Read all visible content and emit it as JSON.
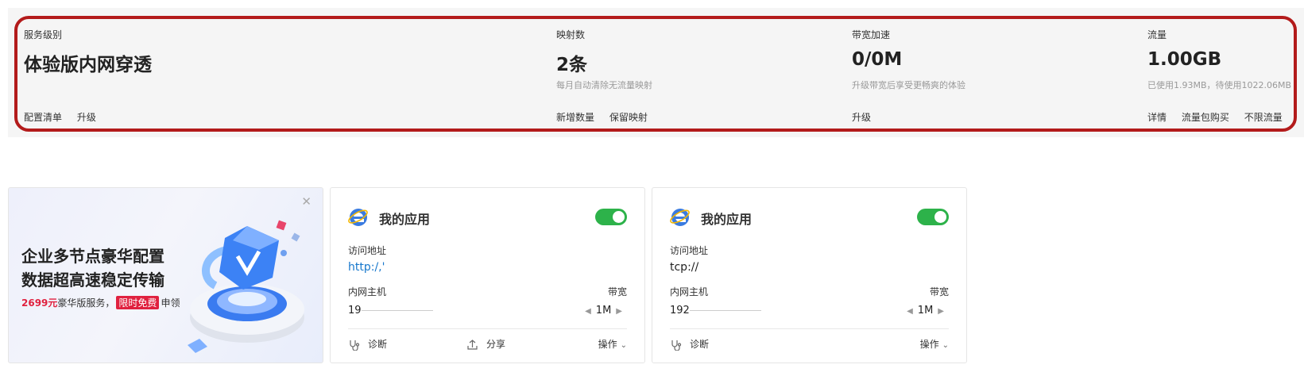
{
  "stats": {
    "service": {
      "label": "服务级别",
      "value": "体验版内网穿透",
      "links": [
        "配置清单",
        "升级"
      ]
    },
    "mapping": {
      "label": "映射数",
      "value": "2条",
      "sub": "每月自动清除无流量映射",
      "links": [
        "新增数量",
        "保留映射"
      ]
    },
    "bandwidth": {
      "label": "带宽加速",
      "value": "0/0M",
      "sub": "升级带宽后享受更畅爽的体验",
      "links": [
        "升级"
      ]
    },
    "traffic": {
      "label": "流量",
      "value": "1.00GB",
      "sub": "已使用1.93MB，待使用1022.06MB",
      "links": [
        "详情",
        "流量包购买",
        "不限流量"
      ]
    }
  },
  "promo": {
    "line1": "企业多节点豪华配置",
    "line2": "数据超高速稳定传输",
    "price": "2699元",
    "text": "豪华版服务，",
    "badge": "限时免费",
    "suffix": "申领",
    "close_icon": "close-icon"
  },
  "cards": [
    {
      "title": "我的应用",
      "enabled": true,
      "addr_label": "访问地址",
      "addr_value": "http:/,'",
      "host_label": "内网主机",
      "host_value": "19",
      "bw_label": "带宽",
      "bw_value": "1M",
      "actions": {
        "diag": "诊断",
        "share": "分享",
        "ops": "操作"
      }
    },
    {
      "title": "我的应用",
      "enabled": true,
      "addr_label": "访问地址",
      "addr_value": "tcp://",
      "host_label": "内网主机",
      "host_value": "192",
      "bw_label": "带宽",
      "bw_value": "1M",
      "actions": {
        "diag": "诊断",
        "ops": "操作"
      }
    }
  ],
  "colors": {
    "accent_green": "#2db24a",
    "link_blue": "#1677cc",
    "highlight_red": "#b31b1b",
    "promo_red": "#e0213f"
  }
}
